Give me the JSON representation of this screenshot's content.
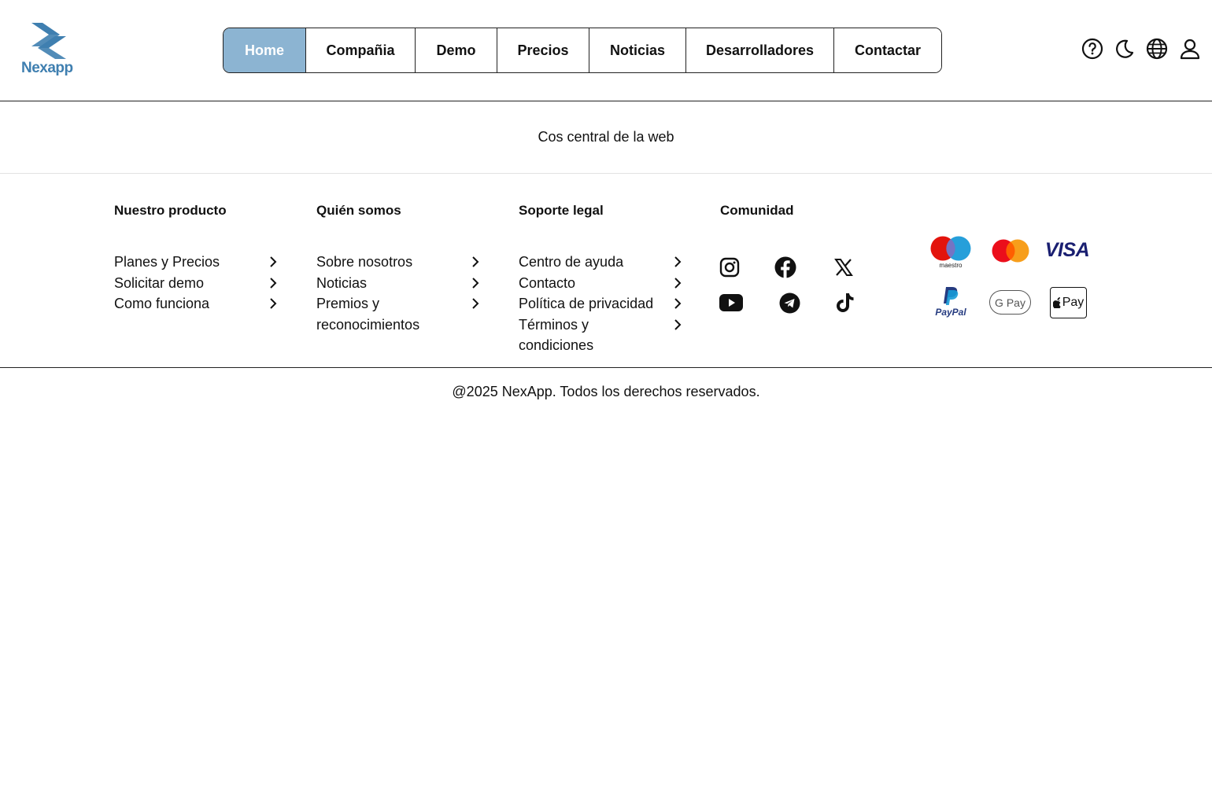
{
  "brand": {
    "logo_text": "Nexapp",
    "color": "#3f7fb0"
  },
  "nav": {
    "items": [
      {
        "label": "Home",
        "active": true
      },
      {
        "label": "Compañia"
      },
      {
        "label": "Demo"
      },
      {
        "label": "Precios"
      },
      {
        "label": "Noticias"
      },
      {
        "label": "Desarrolladores"
      },
      {
        "label": "Contactar"
      }
    ],
    "active_color": "#8cb4d2"
  },
  "header_icons": [
    "help-icon",
    "moon-icon",
    "globe-icon",
    "user-icon"
  ],
  "central": {
    "text": "Cos central de la web"
  },
  "footer": {
    "columns": [
      {
        "title": "Nuestro producto",
        "links": [
          "Planes y Precios",
          "Solicitar demo",
          "Como funciona"
        ]
      },
      {
        "title": "Quién somos",
        "links": [
          "Sobre nosotros",
          "Noticias",
          "Premios y reconocimientos"
        ]
      },
      {
        "title": "Soporte legal",
        "links": [
          "Centro de ayuda",
          "Contacto",
          "Política de privacidad",
          "Términos y condiciones"
        ]
      }
    ],
    "community": {
      "title": "Comunidad",
      "icons": [
        "instagram-icon",
        "facebook-icon",
        "x-icon",
        "youtube-icon",
        "telegram-icon",
        "tiktok-icon"
      ]
    },
    "payments": {
      "maestro": "maestro",
      "visa": "VISA",
      "paypal": "PayPal",
      "gpay": "G Pay",
      "applepay": "Pay"
    },
    "copyright": "@2025 NexApp. Todos los derechos reservados."
  }
}
